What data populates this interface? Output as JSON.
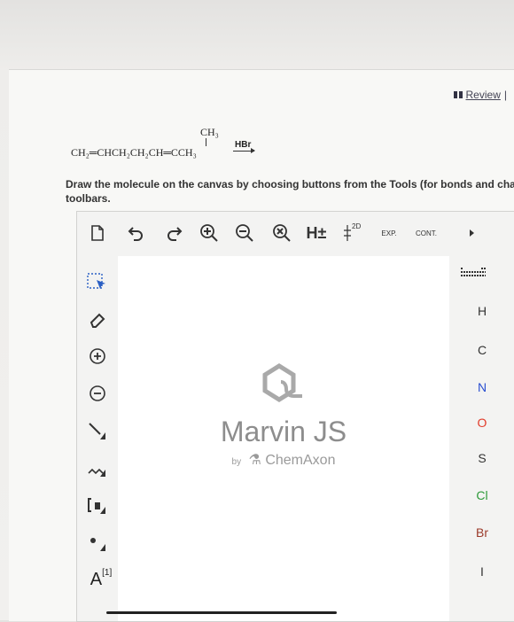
{
  "header": {
    "review_label": "Review",
    "review_suffix": "|"
  },
  "reaction": {
    "substituent": "CH₃",
    "main": "CH₂═CHCH₂CH₂CH═CCH₃",
    "reagent": "HBr"
  },
  "instructions": "Draw the molecule on the canvas by choosing buttons from the Tools (for bonds and cha toolbars.",
  "toolbar": {
    "hydrogens_label": "H±",
    "two_d_label": "2D",
    "expand_label": "EXP.",
    "contract_label": "CONT."
  },
  "lefttools": {
    "charge_label": "A",
    "charge_superscript": "[1]"
  },
  "canvas": {
    "logo_title": "Marvin JS",
    "logo_by": "by",
    "logo_company": "ChemAxon"
  },
  "elements": [
    "H",
    "C",
    "N",
    "O",
    "S",
    "Cl",
    "Br",
    "I"
  ],
  "colors": {
    "oxygen": "#e23b2a",
    "nitrogen": "#2a4fd1",
    "chlorine": "#2e9a3a",
    "bromine": "#9b3a2a"
  }
}
